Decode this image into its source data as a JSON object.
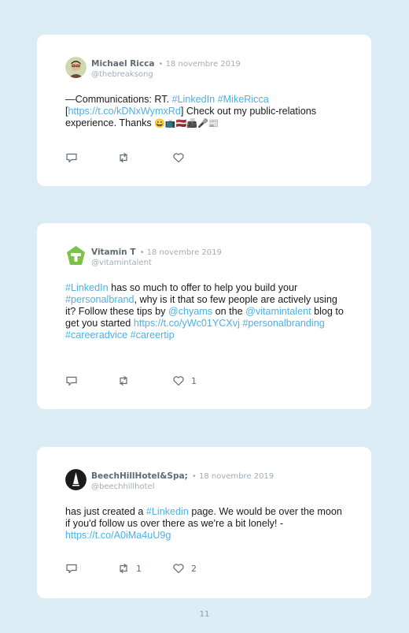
{
  "tweets": [
    {
      "name": "Michael Ricca",
      "date": "• 18 novembre 2019",
      "handle": "@thebreaksong",
      "body": {
        "t1": "—Communications: RT. ",
        "l1": "#LinkedIn",
        "t2": " ",
        "l2": "#MikeRicca",
        "t3": "[",
        "l3": "https://t.co/kDNxWymxRd",
        "t4": "] Check out my public-relations experience. Thanks",
        "emoji": "😀📺🇱🇻📠🎤📰"
      },
      "replies": "",
      "retweets": "",
      "likes": ""
    },
    {
      "name": "Vitamin T",
      "date": "• 18 novembre 2019",
      "handle": "@vitamintalent",
      "body": {
        "l1": "#LinkedIn",
        "t1": " has so much to offer to help you build your ",
        "l2": "#personalbrand",
        "t2": ", why is it that so few people are actively using it? Follow these tips by ",
        "l3": "@chyams",
        "t3": " on the ",
        "l4": "@vitamintalent",
        "t4": " blog to get you started ",
        "l5": "https://t.co/yWc01YCXvj",
        "t5": " ",
        "l6": "#personalbranding",
        "t6": " ",
        "l7": "#careeradvice",
        "t7": " ",
        "l8": "#careertip"
      },
      "replies": "",
      "retweets": "",
      "likes": "1"
    },
    {
      "name": "BeechHillHotel&Spa;",
      "date": "• 18 novembre 2019",
      "handle": "@beechhillhotel",
      "body": {
        "t1": "has just created a ",
        "l1": "#Linkedin",
        "t2": " page. We would be over the moon if you'd follow us over there as we're a bit lonely! - ",
        "l2": "https://t.co/A0iMa4uU9g"
      },
      "replies": "",
      "retweets": "1",
      "likes": "2"
    }
  ],
  "page_number": "11",
  "colors": {
    "background": "#dcecf5",
    "card": "#ffffff",
    "link": "#4db0e2",
    "meta": "#a2adb6",
    "name": "#5e6a75"
  },
  "icons": [
    "reply-icon",
    "retweet-icon",
    "like-icon"
  ]
}
